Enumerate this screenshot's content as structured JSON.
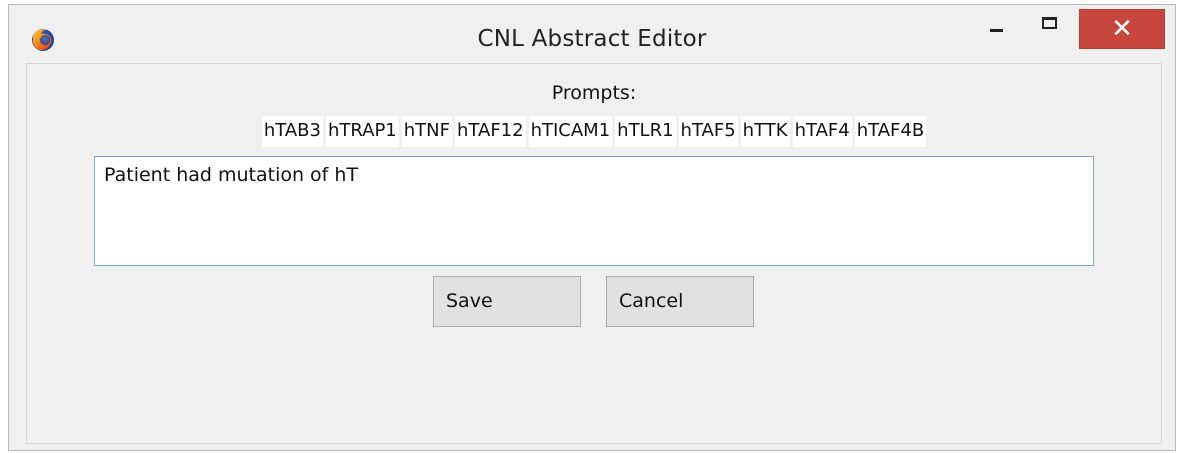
{
  "window": {
    "title": "CNL Abstract Editor",
    "app_icon": "firefox-icon",
    "controls": {
      "minimize_icon": "minimize-icon",
      "maximize_icon": "maximize-icon",
      "close_label": "✕"
    }
  },
  "prompts": {
    "label": "Prompts:",
    "items": [
      "hTAB3",
      "hTRAP1",
      "hTNF",
      "hTAF12",
      "hTICAM1",
      "hTLR1",
      "hTAF5",
      "hTTK",
      "hTAF4",
      "hTAF4B"
    ]
  },
  "editor": {
    "value": "Patient had mutation of hT"
  },
  "buttons": {
    "save": "Save",
    "cancel": "Cancel"
  },
  "colors": {
    "close_button": "#c7463d",
    "input_border": "#7aa7d9",
    "window_background": "#f0f0f0"
  }
}
